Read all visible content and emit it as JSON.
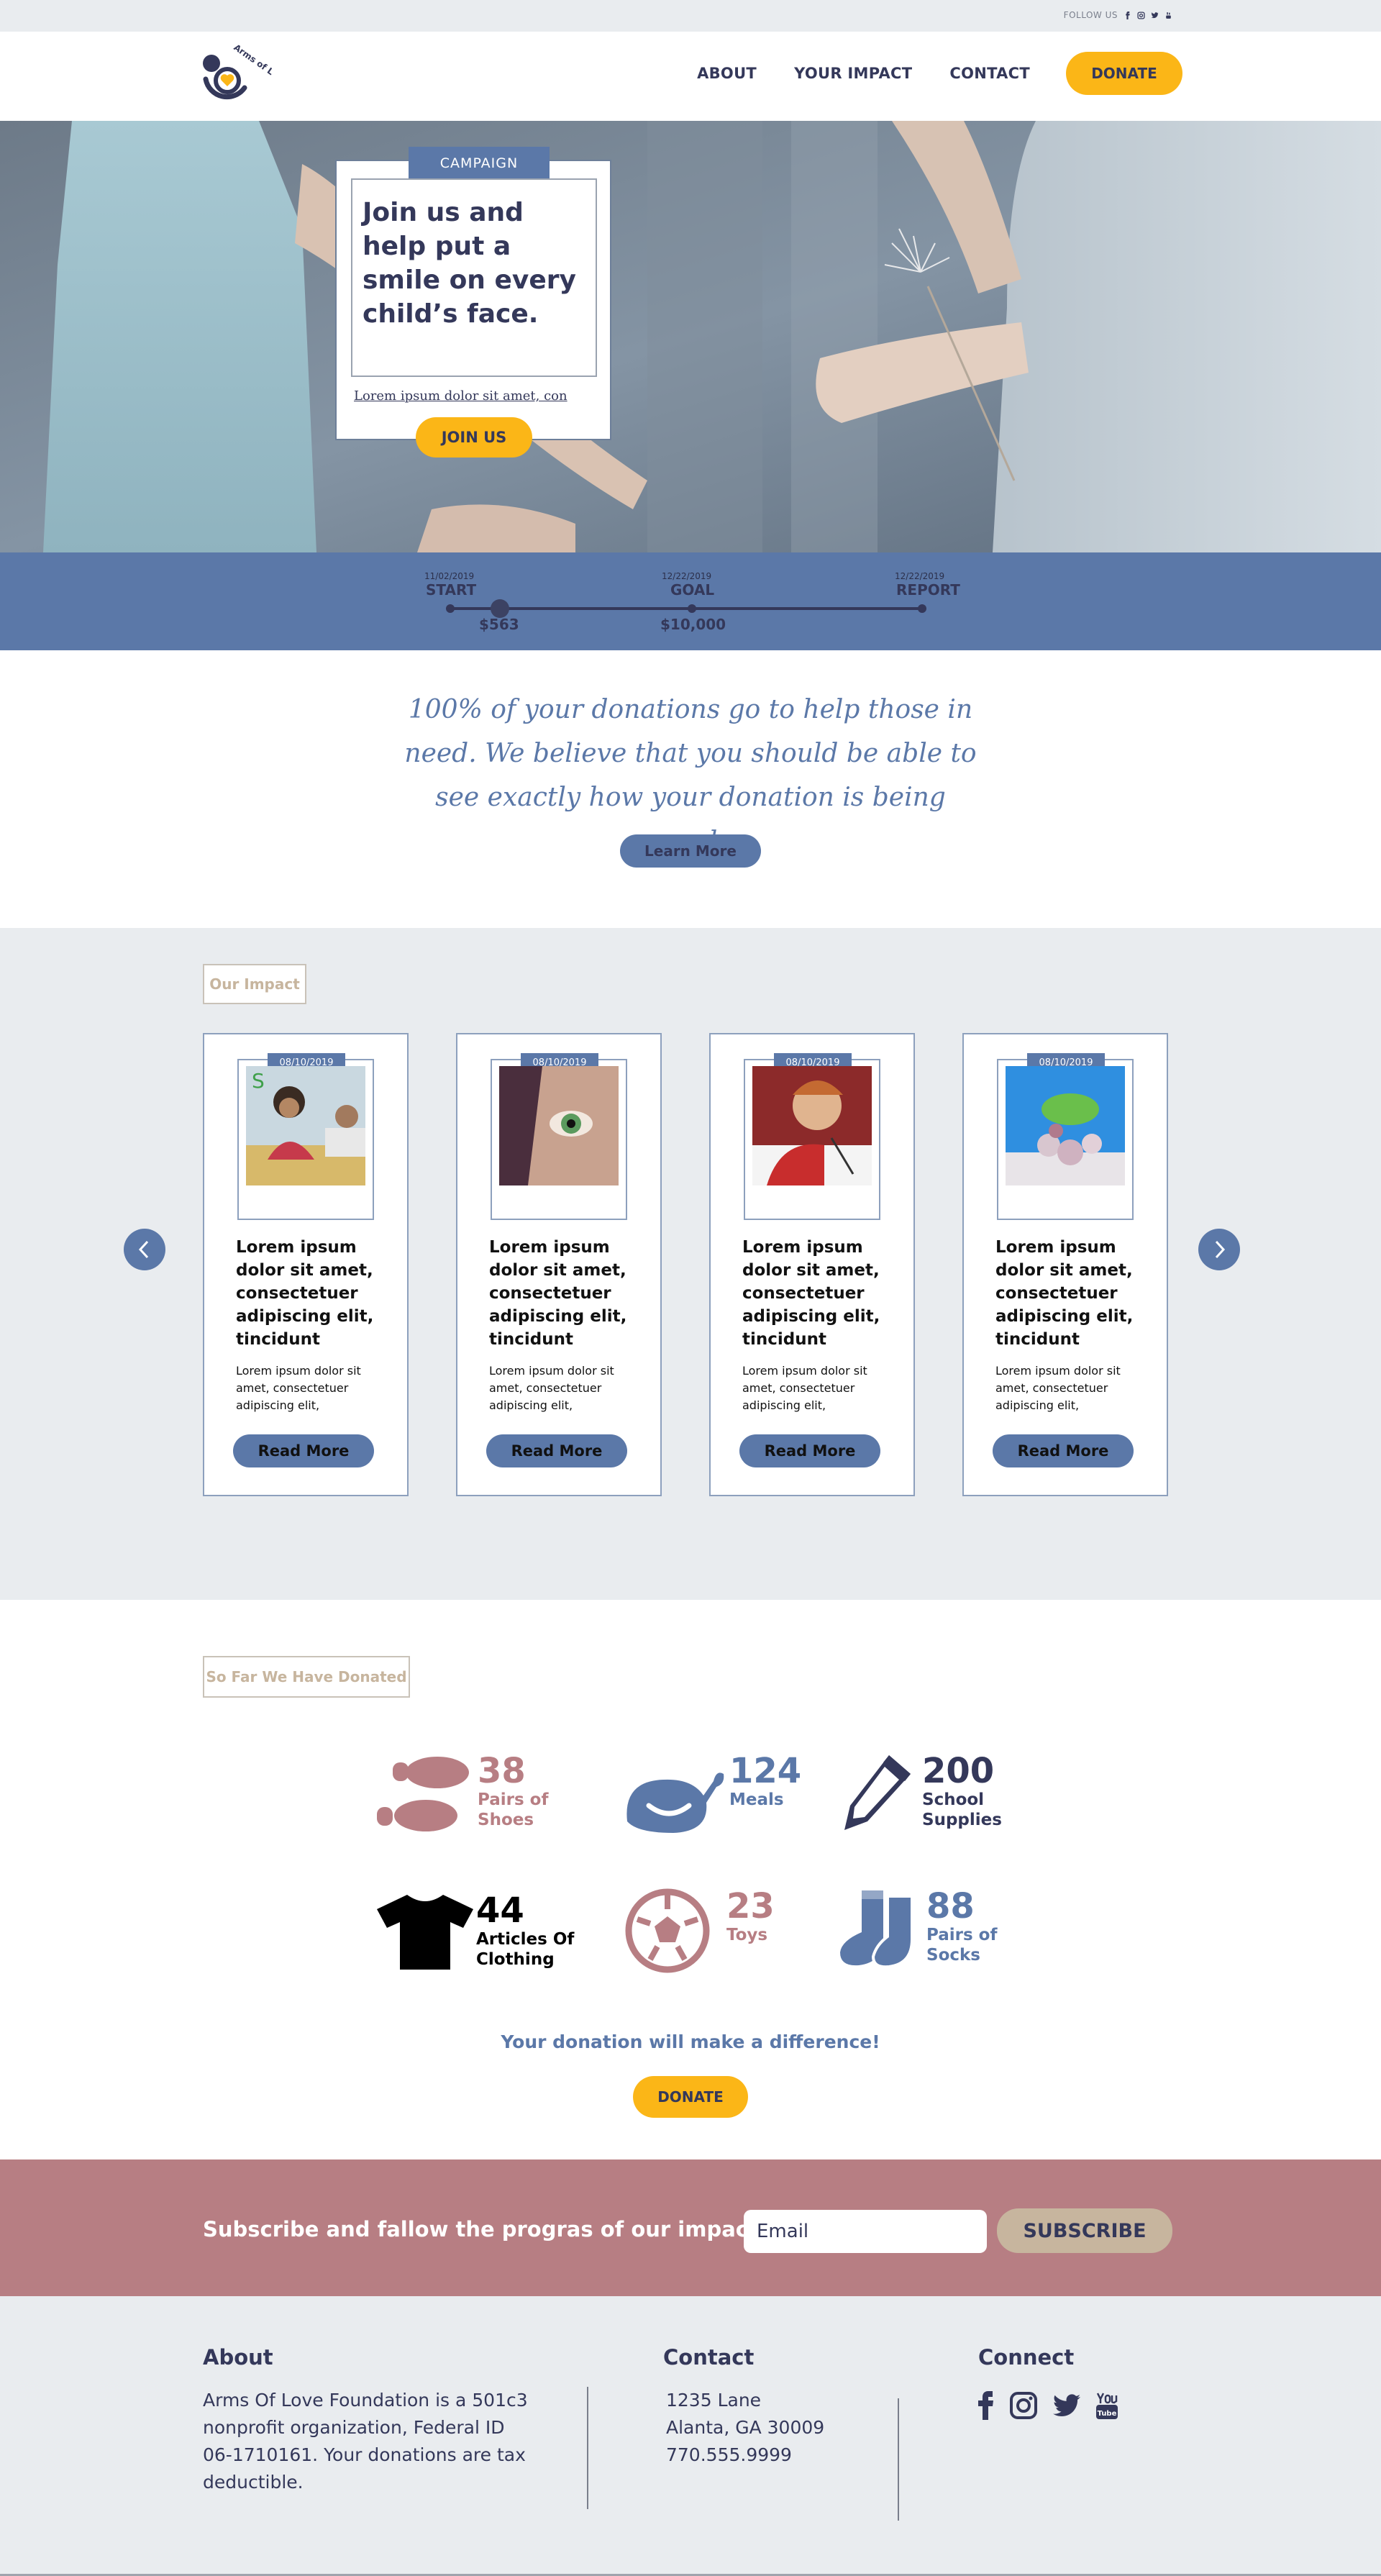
{
  "header": {
    "follow_label": "FOLLOW US",
    "logo_text": "Arms of Love",
    "nav": [
      "ABOUT",
      "YOUR IMPACT",
      "CONTACT"
    ],
    "donate_label": "DONATE"
  },
  "hero": {
    "tag": "CAMPAIGN",
    "title": "Join us and help put a smile on every child’s face.",
    "link": "Lorem ipsum dolor sit amet, con",
    "join_label": "JOIN US"
  },
  "progress": {
    "start": {
      "date": "11/02/2019",
      "label": "START"
    },
    "goal": {
      "date": "12/22/2019",
      "label": "GOAL"
    },
    "report": {
      "date": "12/22/2019",
      "label": "REPORT"
    },
    "raised": "$563",
    "target": "$10,000"
  },
  "mission": {
    "text": "100% of your donations go to help those in need. We believe that you should be able to see exactly how your donation is being used.",
    "learn_label": "Learn More"
  },
  "impact": {
    "label": "Our Impact",
    "cards": [
      {
        "date": "08/10/2019",
        "title": "Lorem ipsum dolor sit amet, consectetuer adipiscing elit, tincidunt",
        "text": "Lorem ipsum dolor sit amet, consectetuer adipiscing elit,",
        "button": "Read More",
        "image": "children-drawing"
      },
      {
        "date": "08/10/2019",
        "title": "Lorem ipsum dolor sit amet, consectetuer adipiscing elit, tincidunt",
        "text": "Lorem ipsum dolor sit amet, consectetuer adipiscing elit,",
        "button": "Read More",
        "image": "child-eye-closeup"
      },
      {
        "date": "08/10/2019",
        "title": "Lorem ipsum dolor sit amet, consectetuer adipiscing elit, tincidunt",
        "text": "Lorem ipsum dolor sit amet, consectetuer adipiscing elit,",
        "button": "Read More",
        "image": "boy-writing"
      },
      {
        "date": "08/10/2019",
        "title": "Lorem ipsum dolor sit amet, consectetuer adipiscing elit, tincidunt",
        "text": "Lorem ipsum dolor sit amet, consectetuer adipiscing elit,",
        "button": "Read More",
        "image": "flowers-still-life"
      }
    ]
  },
  "donated": {
    "label": "So Far We Have Donated",
    "stats": [
      {
        "number": "38",
        "label": "Pairs of Shoes",
        "icon": "footprints-icon",
        "color": "#b77e83"
      },
      {
        "number": "124",
        "label": "Meals",
        "icon": "turkey-icon",
        "color": "#5b78a8"
      },
      {
        "number": "200",
        "label": "School Supplies",
        "icon": "pencil-icon",
        "color": "#34385a"
      },
      {
        "number": "44",
        "label": "Articles Of Clothing",
        "icon": "tshirt-icon",
        "color": "#000000"
      },
      {
        "number": "23",
        "label": "Toys",
        "icon": "soccer-ball-icon",
        "color": "#b77e83"
      },
      {
        "number": "88",
        "label": "Pairs of Socks",
        "icon": "socks-icon",
        "color": "#5b78a8"
      }
    ],
    "difference": "Your donation will make a difference!",
    "donate_label": "DONATE"
  },
  "subscribe": {
    "text": "Subscribe and fallow the progras of our impact",
    "email_placeholder": "Email",
    "button": "SUBSCRIBE"
  },
  "footer": {
    "about_head": "About",
    "about_lines": [
      "Arms Of Love Foundation is a 501c3",
      "nonprofit organization, Federal ID",
      "06-1710161. Your donations are tax",
      "deductible."
    ],
    "contact_head": "Contact",
    "contact_lines": [
      "1235 Lane",
      "Alanta, GA 30009",
      "770.555.9999"
    ],
    "connect_head": "Connect",
    "social": [
      "facebook-icon",
      "instagram-icon",
      "twitter-icon",
      "youtube-icon"
    ]
  },
  "colors": {
    "navy": "#34385a",
    "blue": "#5b78a8",
    "yellow": "#fbb617",
    "rose": "#b77e83",
    "sand": "#c7b59e",
    "light": "#e9ecef"
  }
}
